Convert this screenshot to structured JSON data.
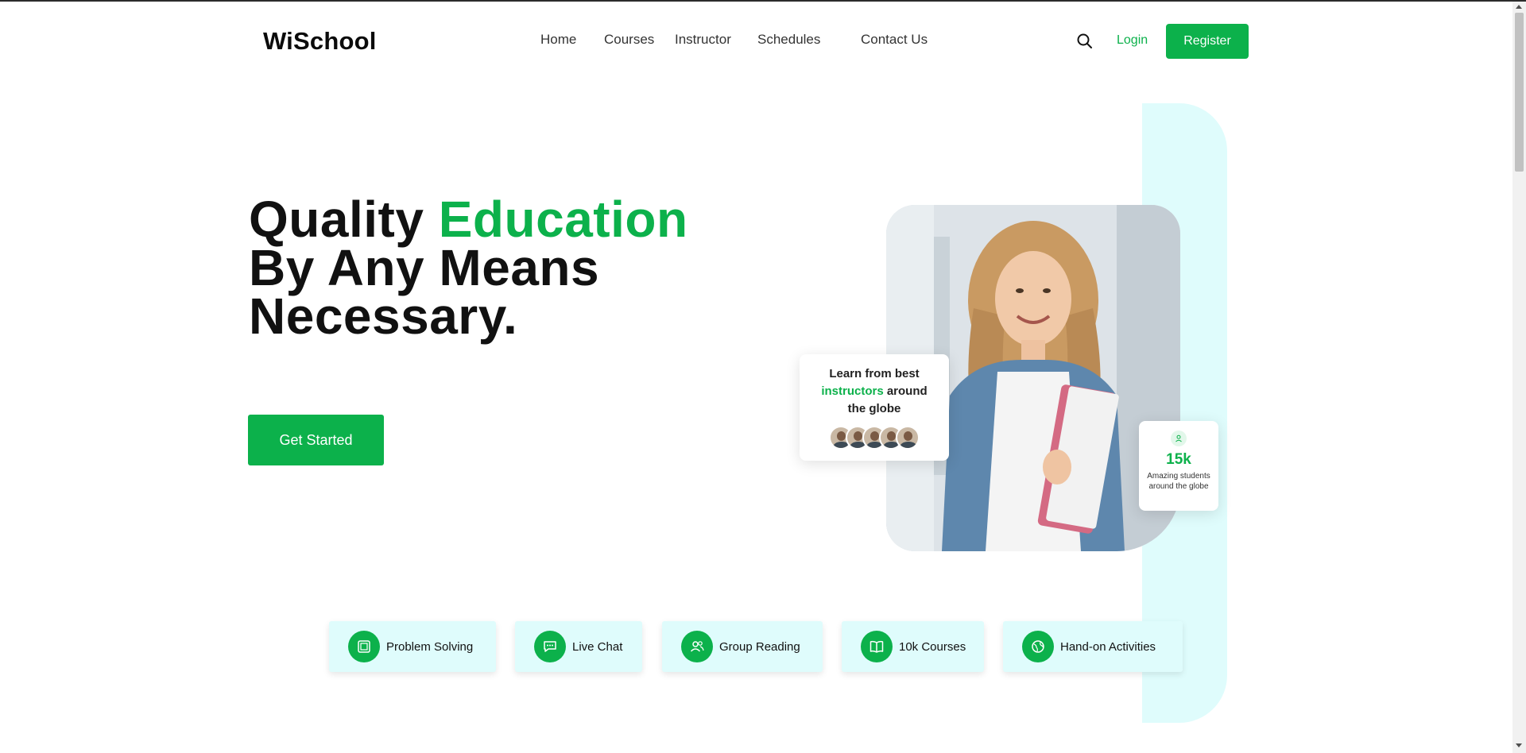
{
  "header": {
    "logo": "WiSchool",
    "nav": [
      "Home",
      "Courses",
      "Instructor",
      "Schedules",
      "Contact Us"
    ],
    "search_icon": "search-icon",
    "login_label": "Login",
    "register_label": "Register"
  },
  "hero": {
    "title_line1_prefix": "Quality ",
    "title_line1_accent": "Education",
    "title_line2": "By Any Means",
    "title_line3": "Necessary.",
    "cta_label": "Get Started"
  },
  "instructor_card": {
    "text_before": "Learn from best",
    "highlight": "instructors",
    "text_after": "around",
    "text_last": "the globe",
    "avatar_count": 5
  },
  "stats_card": {
    "icon": "user-icon",
    "number": "15k",
    "label": "Amazing students around the globe"
  },
  "features": [
    {
      "label": "Problem Solving",
      "icon": "puzzle-icon"
    },
    {
      "label": "Live Chat",
      "icon": "chat-icon"
    },
    {
      "label": "Group Reading",
      "icon": "users-icon"
    },
    {
      "label": "10k Courses",
      "icon": "book-icon"
    },
    {
      "label": "Hand-on Activities",
      "icon": "globe-icon"
    }
  ],
  "colors": {
    "accent": "#0cb14b",
    "aqua": "#dffcfc",
    "text": "#111111"
  }
}
